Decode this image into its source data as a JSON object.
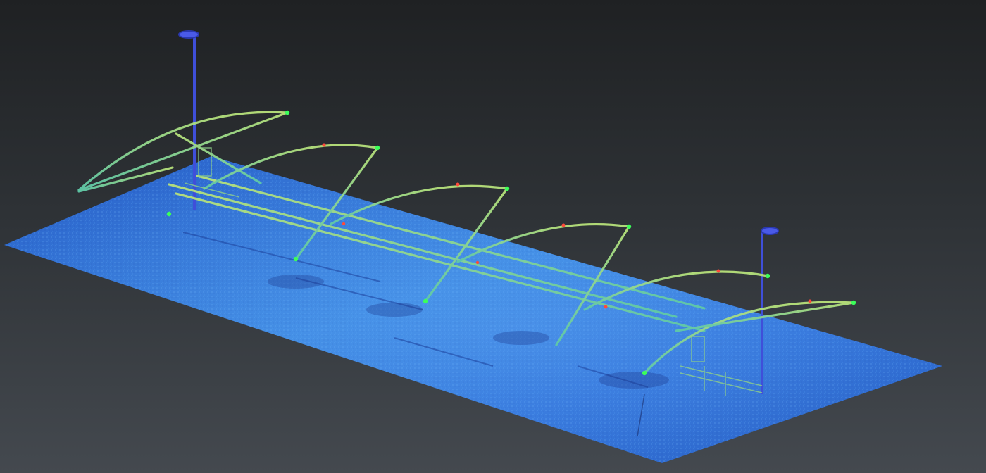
{
  "viewer": {
    "background_top": "#1f2123",
    "background_bottom": "#44494f"
  },
  "point_cloud": {
    "ground_color": "#2f6fd6",
    "ground_edge_color": "#5fa8ff",
    "frame_color": "#9fdc6a",
    "frame_highlight_color": "#d8e86a",
    "hotspot_color": "#ff4a3a",
    "node_color": "#3bff5a",
    "lamp_color": "#3f4fd9"
  }
}
